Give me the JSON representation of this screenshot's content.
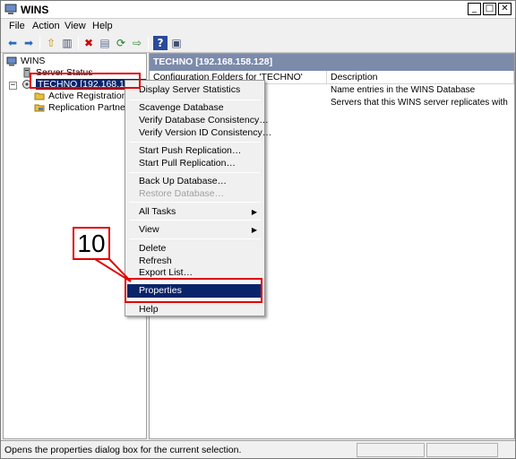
{
  "window": {
    "title": "WINS"
  },
  "menu": {
    "items": [
      "File",
      "Action",
      "View",
      "Help"
    ]
  },
  "window_buttons": [
    "_",
    "□",
    "✕"
  ],
  "toolbar": {
    "icons": [
      "back-icon",
      "forward-icon",
      "up-folder-icon",
      "show-hide-tree-icon",
      "delete-icon",
      "properties-icon",
      "refresh-icon",
      "export-list-icon",
      "help-icon",
      "mmc-window-icon"
    ],
    "glyphs": [
      "⬅",
      "➡",
      "⇧",
      "▥",
      "✖",
      "▤",
      "⟳",
      "⇨",
      "?",
      "▣"
    ]
  },
  "tree": {
    "root": "WINS",
    "server_status": "Server Status",
    "server": "TECHNO [192.168.158.128]",
    "children": [
      "Active Registrations",
      "Replication Partners"
    ]
  },
  "details": {
    "header": "TECHNO [192.168.158.128]",
    "columns": [
      "Configuration Folders for 'TECHNO'",
      "Description"
    ],
    "rows": [
      [
        "",
        "Name entries in the WINS Database"
      ],
      [
        "",
        "Servers that this WINS server replicates with"
      ]
    ]
  },
  "context_menu": {
    "display_stats": "Display Server Statistics",
    "scavenge": "Scavenge Database",
    "verify_db": "Verify Database Consistency…",
    "verify_version": "Verify Version ID Consistency…",
    "push": "Start Push Replication…",
    "pull": "Start Pull Replication…",
    "backup": "Back Up Database…",
    "restore": "Restore Database…",
    "all_tasks": "All Tasks",
    "view": "View",
    "delete": "Delete",
    "refresh": "Refresh",
    "export": "Export List…",
    "properties": "Properties",
    "help": "Help"
  },
  "annotation": {
    "step_number": "10",
    "color": "#e00000"
  },
  "status": {
    "text": "Opens the properties dialog box for the current selection."
  },
  "colors": {
    "selection": "#0a246a",
    "details_header": "#7d8bab",
    "delete_icon": "#d00000"
  }
}
